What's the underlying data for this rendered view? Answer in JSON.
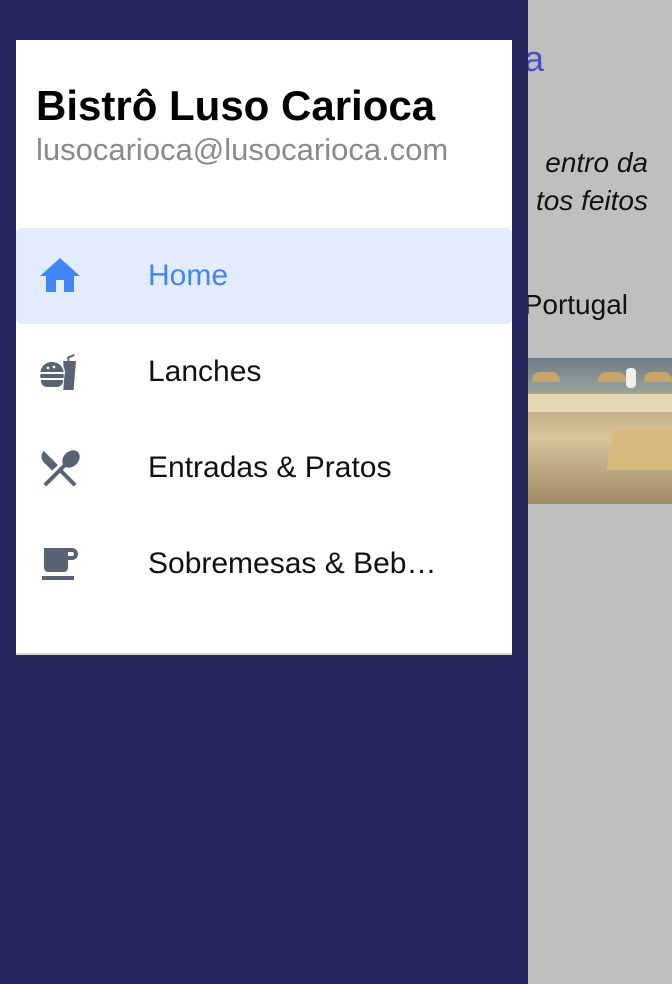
{
  "background_page": {
    "title_fragment": "a",
    "description_line1": "entro da",
    "description_line2": "tos feitos",
    "location_fragment": "Portugal"
  },
  "drawer": {
    "restaurant_name": "Bistrô Luso Carioca",
    "email": "lusocarioca@lusocarioca.com",
    "menu": [
      {
        "label": "Home",
        "icon": "home-icon",
        "active": true
      },
      {
        "label": "Lanches",
        "icon": "burger-drink-icon",
        "active": false
      },
      {
        "label": "Entradas & Pratos",
        "icon": "fork-knife-icon",
        "active": false
      },
      {
        "label": "Sobremesas & Beb…",
        "icon": "coffee-cup-icon",
        "active": false
      }
    ]
  },
  "colors": {
    "drawer_backdrop": "#25275c",
    "active_bg": "#e3ecfd",
    "active_accent": "#4285f4",
    "icon_gray": "#5a6275",
    "email_gray": "#8a8a8a"
  }
}
